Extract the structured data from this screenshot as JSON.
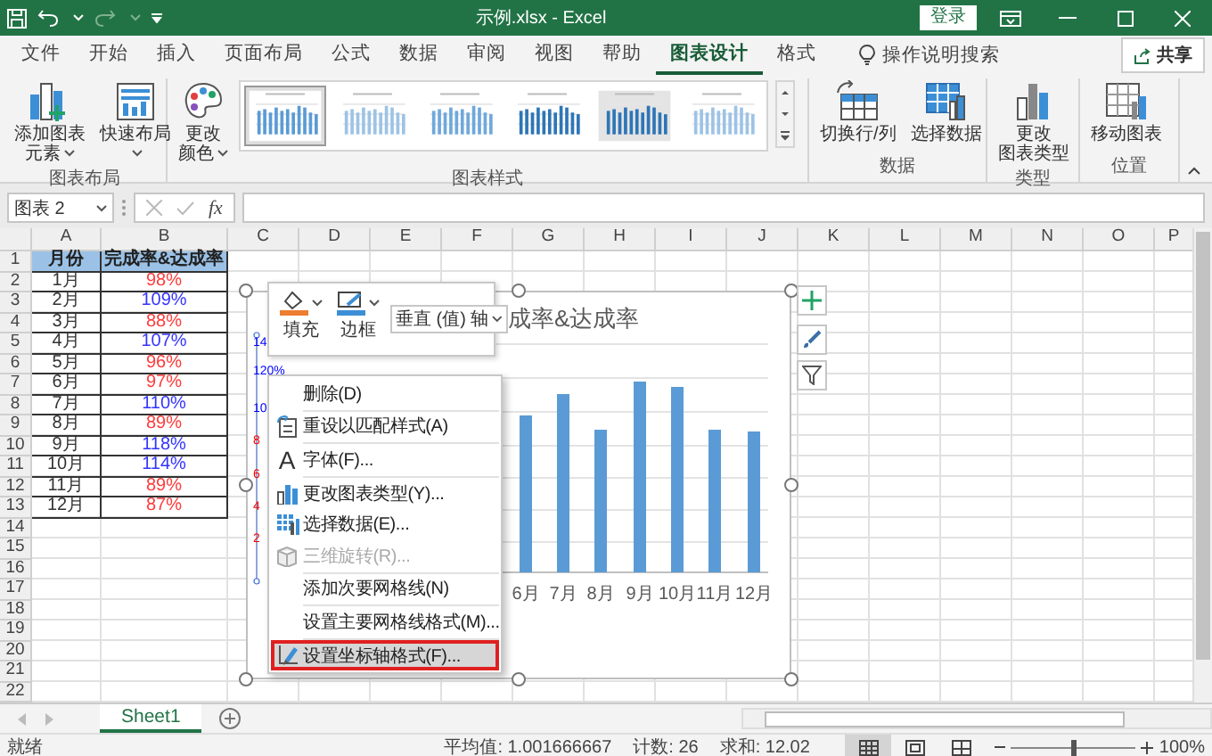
{
  "title_bar": {
    "title": "示例.xlsx  -  Excel",
    "sign_in": "登录"
  },
  "menu_tabs": [
    {
      "label": "文件",
      "selected": false
    },
    {
      "label": "开始",
      "selected": false
    },
    {
      "label": "插入",
      "selected": false
    },
    {
      "label": "页面布局",
      "selected": false
    },
    {
      "label": "公式",
      "selected": false
    },
    {
      "label": "数据",
      "selected": false
    },
    {
      "label": "审阅",
      "selected": false
    },
    {
      "label": "视图",
      "selected": false
    },
    {
      "label": "帮助",
      "selected": false
    },
    {
      "label": "图表设计",
      "selected": true
    },
    {
      "label": "格式",
      "selected": false
    }
  ],
  "tell_me": "操作说明搜索",
  "share": "共享",
  "ribbon": {
    "groups": [
      {
        "label": "图表布局",
        "buttons": [
          {
            "lines": [
              "添加图表",
              "元素"
            ],
            "dropdown": true
          },
          {
            "lines": [
              "快速布局"
            ],
            "dropdown": true
          }
        ]
      },
      {
        "label": "图表样式",
        "buttons": [
          {
            "lines": [
              "更改",
              "颜色"
            ],
            "dropdown": true
          }
        ],
        "gallery": [
          {
            "selected": true
          },
          {
            "selected": false
          },
          {
            "selected": false
          },
          {
            "selected": false
          },
          {
            "selected": false
          },
          {
            "selected": false
          }
        ]
      },
      {
        "label": "数据",
        "buttons": [
          {
            "lines": [
              "切换行/列"
            ],
            "dropdown": false
          },
          {
            "lines": [
              "选择数据"
            ],
            "dropdown": false
          }
        ]
      },
      {
        "label": "类型",
        "buttons": [
          {
            "lines": [
              "更改",
              "图表类型"
            ],
            "dropdown": false
          }
        ]
      },
      {
        "label": "位置",
        "buttons": [
          {
            "lines": [
              "移动图表"
            ],
            "dropdown": false
          }
        ]
      }
    ]
  },
  "formula_bar": {
    "name_box": "图表 2",
    "function_label": "fx"
  },
  "columns": [
    "A",
    "B",
    "C",
    "D",
    "E",
    "F",
    "G",
    "H",
    "I",
    "J",
    "K",
    "L",
    "M",
    "N",
    "O",
    "P"
  ],
  "row_numbers": [
    "1",
    "2",
    "3",
    "4",
    "5",
    "6",
    "7",
    "8",
    "9",
    "10",
    "11",
    "12",
    "13",
    "14",
    "15",
    "16",
    "17",
    "18",
    "19",
    "20",
    "21",
    "22"
  ],
  "table": {
    "headers": [
      "月份",
      "完成率&达成率"
    ],
    "rows": [
      {
        "month": "1月",
        "rate": "98%",
        "color": "#ff3b3b"
      },
      {
        "month": "2月",
        "rate": "109%",
        "color": "#3333ff"
      },
      {
        "month": "3月",
        "rate": "88%",
        "color": "#ff3b3b"
      },
      {
        "month": "4月",
        "rate": "107%",
        "color": "#3333ff"
      },
      {
        "month": "5月",
        "rate": "96%",
        "color": "#ff3b3b"
      },
      {
        "month": "6月",
        "rate": "97%",
        "color": "#ff3b3b"
      },
      {
        "month": "7月",
        "rate": "110%",
        "color": "#3333ff"
      },
      {
        "month": "8月",
        "rate": "89%",
        "color": "#ff3b3b"
      },
      {
        "month": "9月",
        "rate": "118%",
        "color": "#3333ff"
      },
      {
        "month": "10月",
        "rate": "114%",
        "color": "#3333ff"
      },
      {
        "month": "11月",
        "rate": "89%",
        "color": "#ff3b3b"
      },
      {
        "month": "12月",
        "rate": "87%",
        "color": "#ff3b3b"
      }
    ]
  },
  "chart": {
    "title": "成率&达成率",
    "axis_labels": [
      {
        "text": "14",
        "color": "#0000ff"
      },
      {
        "text": "120%",
        "color": "#0000ff"
      },
      {
        "text": "10",
        "color": "#0000ff"
      },
      {
        "text": "8",
        "color": "#ff0000"
      },
      {
        "text": "6",
        "color": "#ff0000"
      },
      {
        "text": "4",
        "color": "#ff0000"
      },
      {
        "text": "2",
        "color": "#ff0000"
      }
    ],
    "categories": [
      "6月",
      "7月",
      "8月",
      "9月",
      "10月",
      "11月",
      "12月"
    ]
  },
  "mini_toolbar": {
    "fill": "填充",
    "border": "边框",
    "element_picker": "垂直 (值) 轴"
  },
  "context_menu": [
    {
      "label": "删除(D)",
      "disabled": false,
      "selected": false,
      "separator": false
    },
    {
      "label": "重设以匹配样式(A)",
      "disabled": false,
      "selected": false,
      "separator": true
    },
    {
      "label": "字体(F)...",
      "glyph": "A",
      "disabled": false,
      "selected": false,
      "separator": true
    },
    {
      "label": "更改图表类型(Y)...",
      "disabled": false,
      "selected": false,
      "separator": true
    },
    {
      "label": "选择数据(E)...",
      "disabled": false,
      "selected": false,
      "separator": false
    },
    {
      "label": "三维旋转(R)...",
      "disabled": true,
      "selected": false,
      "separator": false
    },
    {
      "label": "添加次要网格线(N)",
      "disabled": false,
      "selected": false,
      "separator": true
    },
    {
      "label": "设置主要网格线格式(M)...",
      "disabled": false,
      "selected": false,
      "separator": true
    },
    {
      "label": "设置坐标轴格式(F)...",
      "disabled": false,
      "selected": true,
      "separator": true
    }
  ],
  "sheet_tabs": [
    {
      "label": "Sheet1",
      "selected": true
    }
  ],
  "status_bar": {
    "mode": "就绪",
    "stats": [
      "平均值: 1.001666667",
      "计数: 26",
      "求和: 12.02"
    ],
    "views": [
      {
        "selected": true
      },
      {
        "selected": false
      },
      {
        "selected": false
      }
    ],
    "zoom": {
      "level": 0.5,
      "label": "100%"
    }
  }
}
